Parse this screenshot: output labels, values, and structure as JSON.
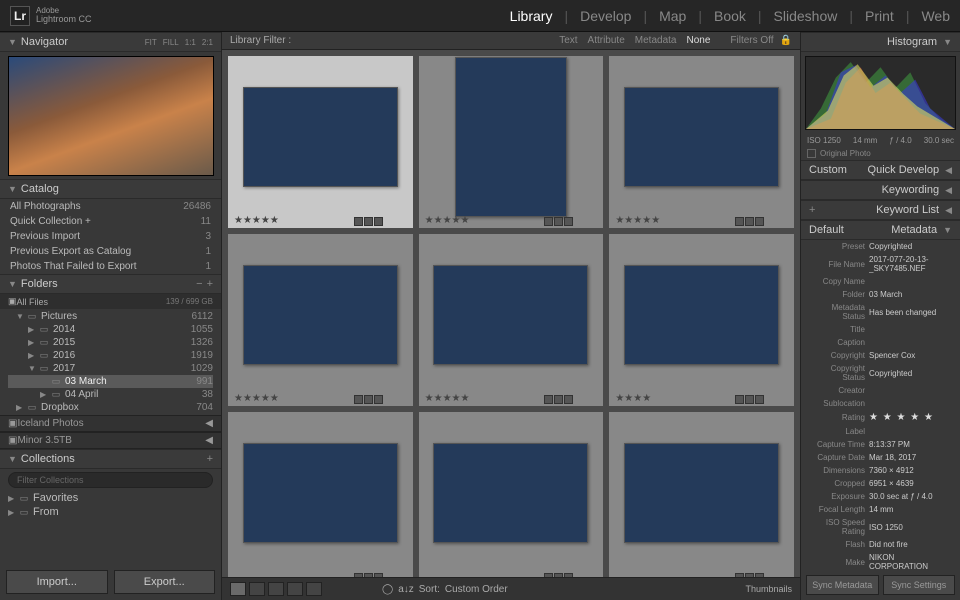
{
  "app": {
    "adobe": "Adobe",
    "name": "Lightroom CC"
  },
  "modules": [
    "Library",
    "Develop",
    "Map",
    "Book",
    "Slideshow",
    "Print",
    "Web"
  ],
  "active_module": "Library",
  "navigator": {
    "title": "Navigator",
    "opts": [
      "FIT",
      "FILL",
      "1:1",
      "2:1"
    ]
  },
  "catalog": {
    "title": "Catalog",
    "rows": [
      {
        "label": "All Photographs",
        "count": "26486"
      },
      {
        "label": "Quick Collection  +",
        "count": "11"
      },
      {
        "label": "Previous Import",
        "count": "3"
      },
      {
        "label": "Previous Export as Catalog",
        "count": "1"
      },
      {
        "label": "Photos That Failed to Export",
        "count": "1"
      }
    ]
  },
  "folders": {
    "title": "Folders",
    "disk": {
      "name": "All Files",
      "size": "139 / 699 GB"
    },
    "tree": [
      {
        "arrow": "▼",
        "indent": 1,
        "label": "Pictures",
        "count": "6112"
      },
      {
        "arrow": "▶",
        "indent": 2,
        "label": "2014",
        "count": "1055"
      },
      {
        "arrow": "▶",
        "indent": 2,
        "label": "2015",
        "count": "1326"
      },
      {
        "arrow": "▶",
        "indent": 2,
        "label": "2016",
        "count": "1919"
      },
      {
        "arrow": "▼",
        "indent": 2,
        "label": "2017",
        "count": "1029"
      },
      {
        "arrow": "",
        "indent": 3,
        "label": "03 March",
        "count": "991",
        "sel": true
      },
      {
        "arrow": "▶",
        "indent": 3,
        "label": "04 April",
        "count": "38"
      },
      {
        "arrow": "▶",
        "indent": 1,
        "label": "Dropbox",
        "count": "704"
      }
    ],
    "collapsed": [
      "Iceland Photos",
      "Minor 3.5TB"
    ]
  },
  "collections": {
    "title": "Collections",
    "filter_placeholder": "Filter Collections",
    "rows": [
      {
        "label": "Favorites"
      },
      {
        "label": "From"
      }
    ]
  },
  "left_buttons": {
    "import": "Import...",
    "export": "Export..."
  },
  "filter_bar": {
    "title": "Library Filter :",
    "tabs": [
      "Text",
      "Attribute",
      "Metadata",
      "None"
    ],
    "active": "None",
    "off": "Filters Off"
  },
  "thumbs": [
    {
      "stars": "★★★★★",
      "cls": "th-land",
      "sel": true
    },
    {
      "stars": "★★★★★",
      "cls": "th-bw"
    },
    {
      "stars": "★★★★★",
      "cls": "th-purp"
    },
    {
      "stars": "★★★★★",
      "cls": "th-land"
    },
    {
      "stars": "★★★★★",
      "cls": "th-bw",
      "wide": true
    },
    {
      "stars": "★★★★",
      "cls": "th-purp"
    },
    {
      "stars": "",
      "cls": "th-cany"
    },
    {
      "stars": "",
      "cls": "th-cany"
    },
    {
      "stars": "",
      "cls": "th-cany"
    }
  ],
  "toolbar": {
    "sort_label": "Sort:",
    "sort_value": "Custom Order",
    "thumb_label": "Thumbnails"
  },
  "histogram": {
    "title": "Histogram",
    "iso": "ISO 1250",
    "fl": "14 mm",
    "ap": "ƒ / 4.0",
    "sh": "30.0 sec",
    "orig": "Original Photo"
  },
  "quick_develop": {
    "title": "Quick Develop",
    "preset": "Custom"
  },
  "keywording": {
    "title": "Keywording"
  },
  "keyword_list": {
    "title": "Keyword List"
  },
  "metadata": {
    "title": "Metadata",
    "mode": "Default",
    "preset": "Copyrighted",
    "rows": [
      {
        "lbl": "File Name",
        "val": "2017-077-20-13-_SKY7485.NEF"
      },
      {
        "lbl": "Copy Name",
        "val": ""
      },
      {
        "lbl": "Folder",
        "val": "03 March"
      },
      {
        "lbl": "Metadata Status",
        "val": "Has been changed"
      },
      {
        "lbl": "Title",
        "val": ""
      },
      {
        "lbl": "Caption",
        "val": ""
      },
      {
        "lbl": "Copyright",
        "val": "Spencer Cox"
      },
      {
        "lbl": "Copyright Status",
        "val": "Copyrighted"
      },
      {
        "lbl": "Creator",
        "val": ""
      },
      {
        "lbl": "Sublocation",
        "val": ""
      },
      {
        "lbl": "Rating",
        "val": "★ ★ ★ ★ ★",
        "stars": true
      },
      {
        "lbl": "Label",
        "val": ""
      },
      {
        "lbl": "Capture Time",
        "val": "8:13:37 PM"
      },
      {
        "lbl": "Capture Date",
        "val": "Mar 18, 2017"
      },
      {
        "lbl": "Dimensions",
        "val": "7360 × 4912"
      },
      {
        "lbl": "Cropped",
        "val": "6951 × 4639"
      },
      {
        "lbl": "Exposure",
        "val": "30.0 sec at ƒ / 4.0"
      },
      {
        "lbl": "Focal Length",
        "val": "14 mm"
      },
      {
        "lbl": "ISO Speed Rating",
        "val": "ISO 1250"
      },
      {
        "lbl": "Flash",
        "val": "Did not fire"
      },
      {
        "lbl": "Make",
        "val": "NIKON CORPORATION"
      }
    ]
  },
  "right_buttons": {
    "sync_meta": "Sync Metadata",
    "sync_set": "Sync Settings"
  }
}
